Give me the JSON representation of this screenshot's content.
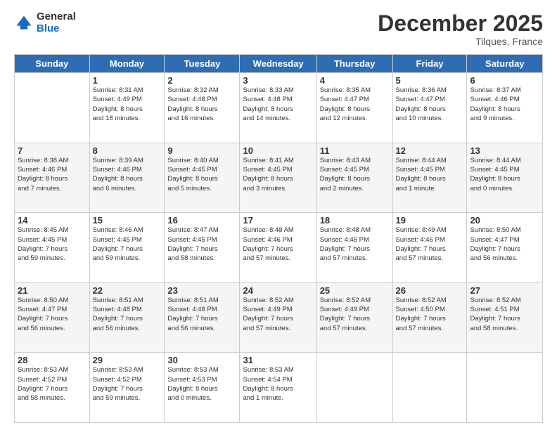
{
  "logo": {
    "general": "General",
    "blue": "Blue"
  },
  "title": "December 2025",
  "location": "Tilques, France",
  "days": [
    "Sunday",
    "Monday",
    "Tuesday",
    "Wednesday",
    "Thursday",
    "Friday",
    "Saturday"
  ],
  "weeks": [
    [
      {
        "num": "",
        "info": ""
      },
      {
        "num": "1",
        "info": "Sunrise: 8:31 AM\nSunset: 4:49 PM\nDaylight: 8 hours\nand 18 minutes."
      },
      {
        "num": "2",
        "info": "Sunrise: 8:32 AM\nSunset: 4:48 PM\nDaylight: 8 hours\nand 16 minutes."
      },
      {
        "num": "3",
        "info": "Sunrise: 8:33 AM\nSunset: 4:48 PM\nDaylight: 8 hours\nand 14 minutes."
      },
      {
        "num": "4",
        "info": "Sunrise: 8:35 AM\nSunset: 4:47 PM\nDaylight: 8 hours\nand 12 minutes."
      },
      {
        "num": "5",
        "info": "Sunrise: 8:36 AM\nSunset: 4:47 PM\nDaylight: 8 hours\nand 10 minutes."
      },
      {
        "num": "6",
        "info": "Sunrise: 8:37 AM\nSunset: 4:46 PM\nDaylight: 8 hours\nand 9 minutes."
      }
    ],
    [
      {
        "num": "7",
        "info": "Sunrise: 8:38 AM\nSunset: 4:46 PM\nDaylight: 8 hours\nand 7 minutes."
      },
      {
        "num": "8",
        "info": "Sunrise: 8:39 AM\nSunset: 4:46 PM\nDaylight: 8 hours\nand 6 minutes."
      },
      {
        "num": "9",
        "info": "Sunrise: 8:40 AM\nSunset: 4:45 PM\nDaylight: 8 hours\nand 5 minutes."
      },
      {
        "num": "10",
        "info": "Sunrise: 8:41 AM\nSunset: 4:45 PM\nDaylight: 8 hours\nand 3 minutes."
      },
      {
        "num": "11",
        "info": "Sunrise: 8:43 AM\nSunset: 4:45 PM\nDaylight: 8 hours\nand 2 minutes."
      },
      {
        "num": "12",
        "info": "Sunrise: 8:44 AM\nSunset: 4:45 PM\nDaylight: 8 hours\nand 1 minute."
      },
      {
        "num": "13",
        "info": "Sunrise: 8:44 AM\nSunset: 4:45 PM\nDaylight: 8 hours\nand 0 minutes."
      }
    ],
    [
      {
        "num": "14",
        "info": "Sunrise: 8:45 AM\nSunset: 4:45 PM\nDaylight: 7 hours\nand 59 minutes."
      },
      {
        "num": "15",
        "info": "Sunrise: 8:46 AM\nSunset: 4:45 PM\nDaylight: 7 hours\nand 59 minutes."
      },
      {
        "num": "16",
        "info": "Sunrise: 8:47 AM\nSunset: 4:45 PM\nDaylight: 7 hours\nand 58 minutes."
      },
      {
        "num": "17",
        "info": "Sunrise: 8:48 AM\nSunset: 4:46 PM\nDaylight: 7 hours\nand 57 minutes."
      },
      {
        "num": "18",
        "info": "Sunrise: 8:48 AM\nSunset: 4:46 PM\nDaylight: 7 hours\nand 57 minutes."
      },
      {
        "num": "19",
        "info": "Sunrise: 8:49 AM\nSunset: 4:46 PM\nDaylight: 7 hours\nand 57 minutes."
      },
      {
        "num": "20",
        "info": "Sunrise: 8:50 AM\nSunset: 4:47 PM\nDaylight: 7 hours\nand 56 minutes."
      }
    ],
    [
      {
        "num": "21",
        "info": "Sunrise: 8:50 AM\nSunset: 4:47 PM\nDaylight: 7 hours\nand 56 minutes."
      },
      {
        "num": "22",
        "info": "Sunrise: 8:51 AM\nSunset: 4:48 PM\nDaylight: 7 hours\nand 56 minutes."
      },
      {
        "num": "23",
        "info": "Sunrise: 8:51 AM\nSunset: 4:48 PM\nDaylight: 7 hours\nand 56 minutes."
      },
      {
        "num": "24",
        "info": "Sunrise: 8:52 AM\nSunset: 4:49 PM\nDaylight: 7 hours\nand 57 minutes."
      },
      {
        "num": "25",
        "info": "Sunrise: 8:52 AM\nSunset: 4:49 PM\nDaylight: 7 hours\nand 57 minutes."
      },
      {
        "num": "26",
        "info": "Sunrise: 8:52 AM\nSunset: 4:50 PM\nDaylight: 7 hours\nand 57 minutes."
      },
      {
        "num": "27",
        "info": "Sunrise: 8:52 AM\nSunset: 4:51 PM\nDaylight: 7 hours\nand 58 minutes."
      }
    ],
    [
      {
        "num": "28",
        "info": "Sunrise: 8:53 AM\nSunset: 4:52 PM\nDaylight: 7 hours\nand 58 minutes."
      },
      {
        "num": "29",
        "info": "Sunrise: 8:53 AM\nSunset: 4:52 PM\nDaylight: 7 hours\nand 59 minutes."
      },
      {
        "num": "30",
        "info": "Sunrise: 8:53 AM\nSunset: 4:53 PM\nDaylight: 8 hours\nand 0 minutes."
      },
      {
        "num": "31",
        "info": "Sunrise: 8:53 AM\nSunset: 4:54 PM\nDaylight: 8 hours\nand 1 minute."
      },
      {
        "num": "",
        "info": ""
      },
      {
        "num": "",
        "info": ""
      },
      {
        "num": "",
        "info": ""
      }
    ]
  ]
}
